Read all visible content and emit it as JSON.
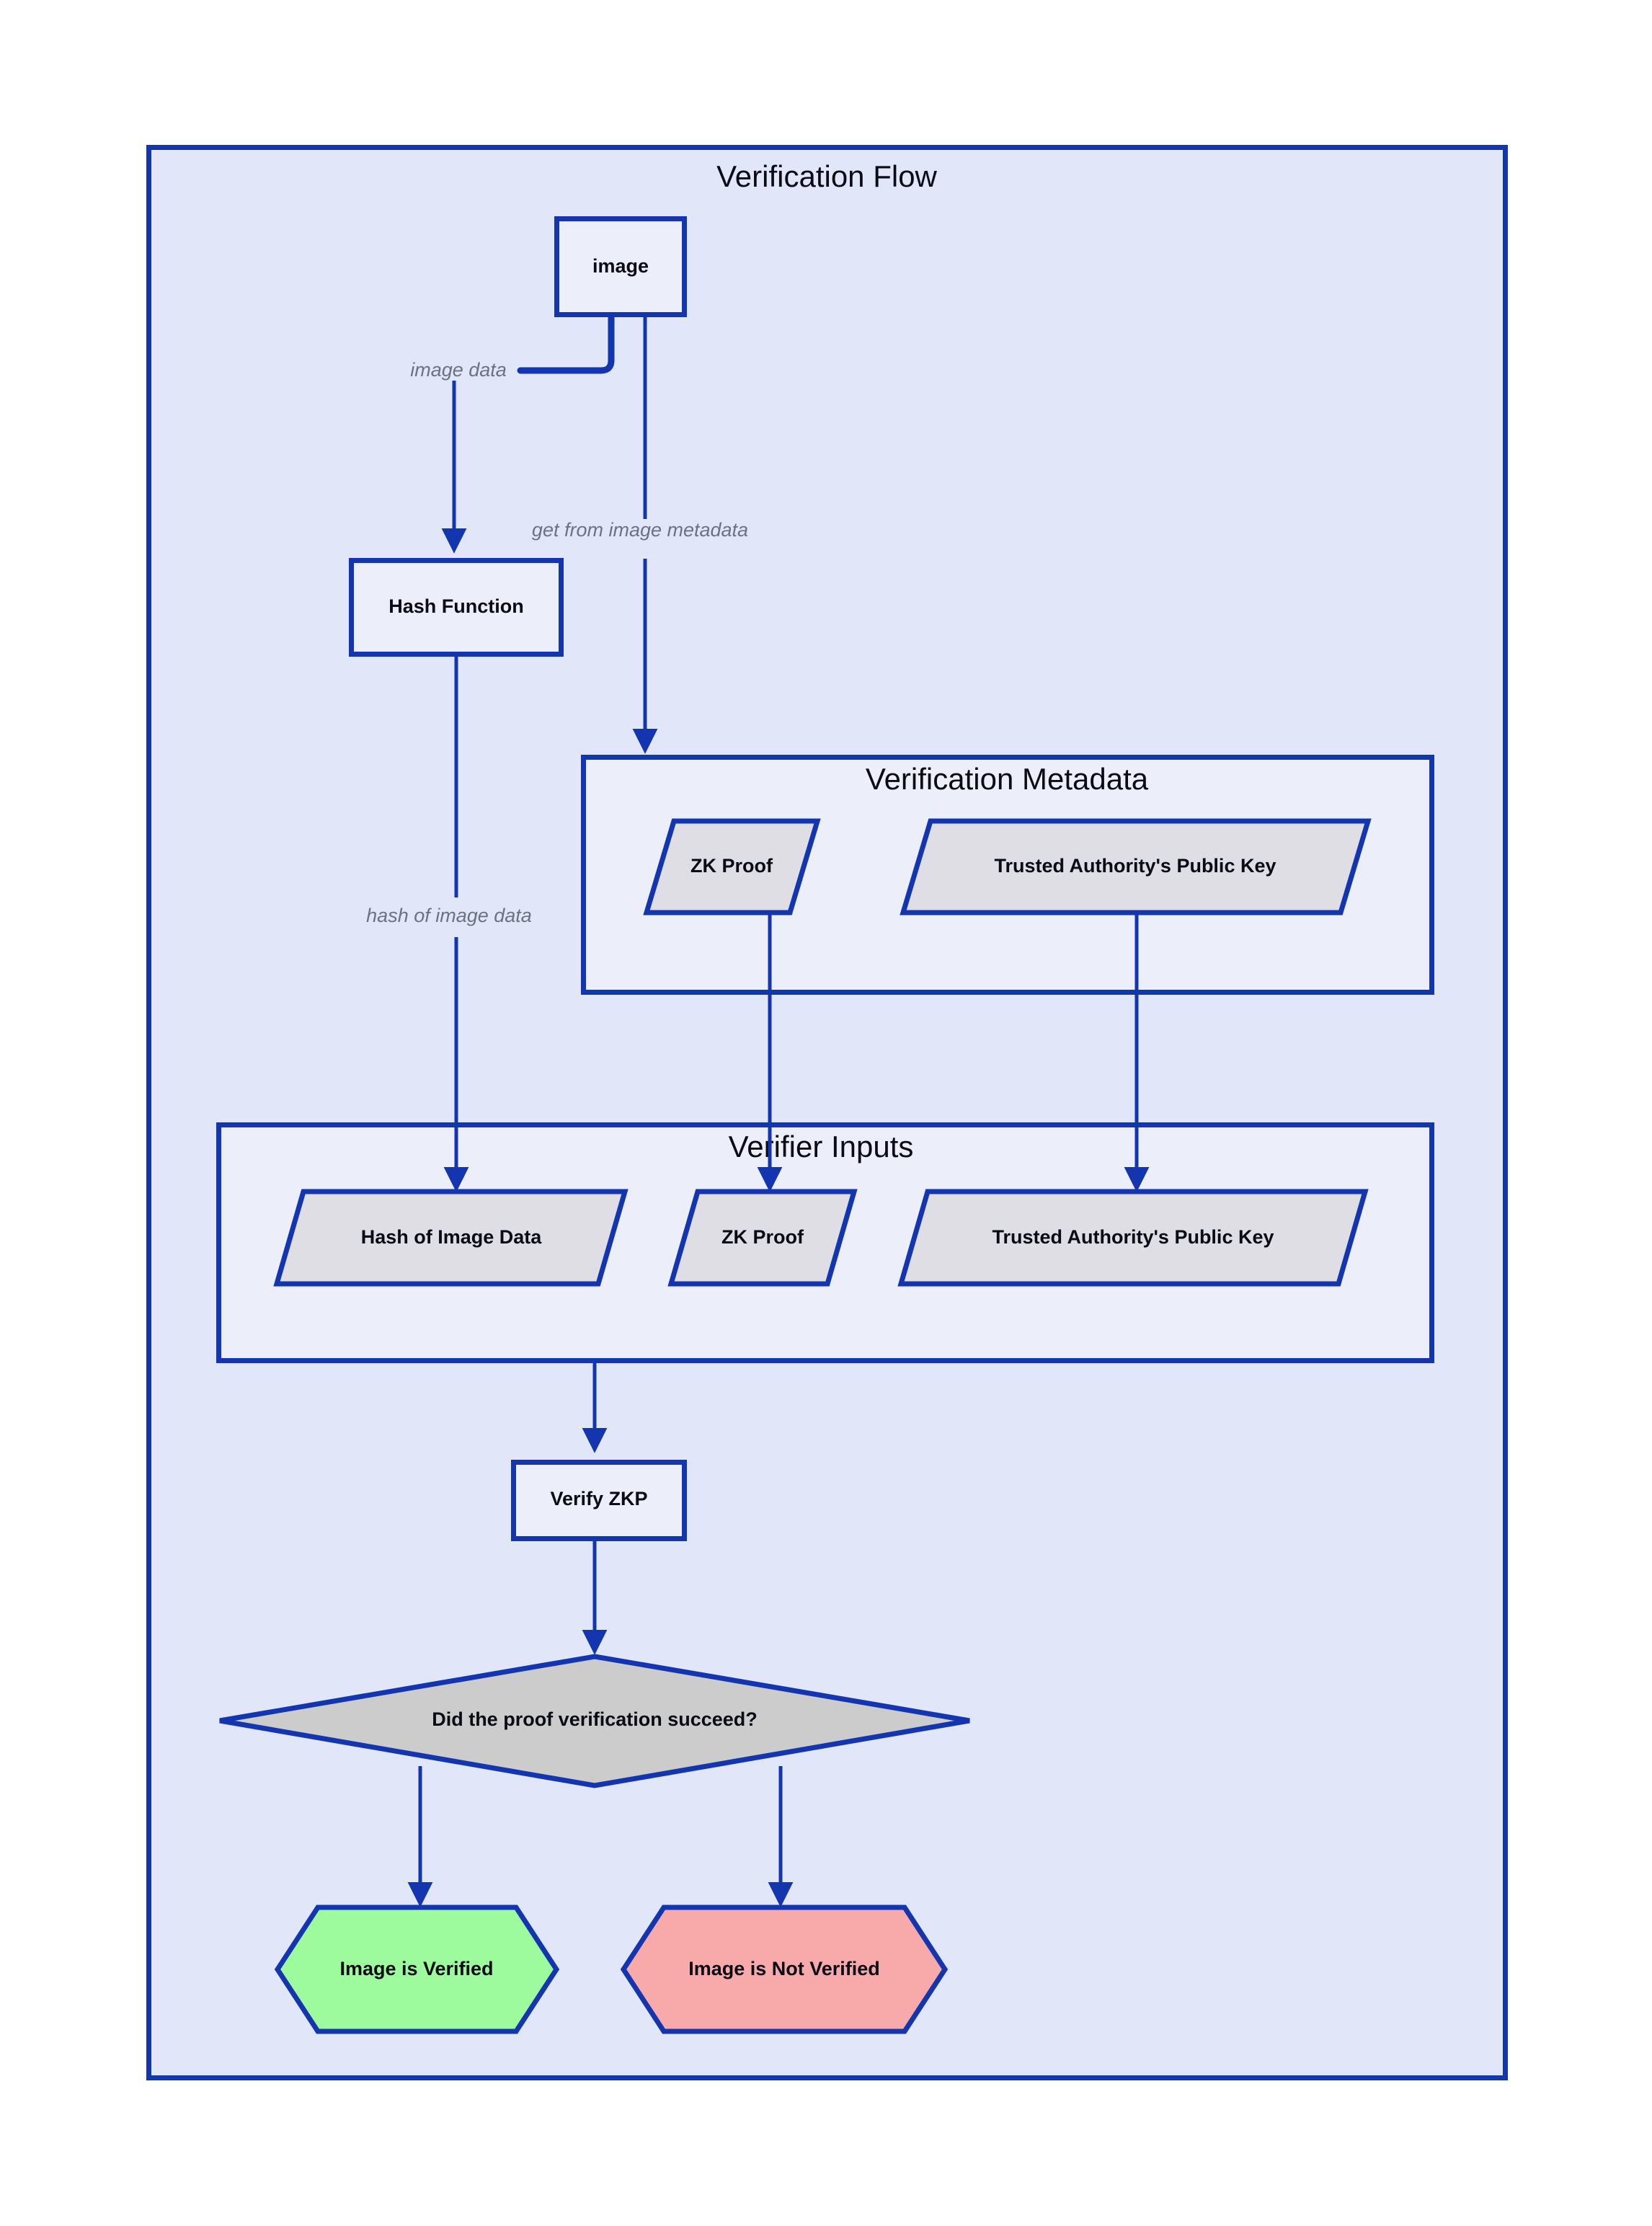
{
  "diagram": {
    "title": "Verification Flow",
    "background_color": "#E1E7F9",
    "border_color": "#1335B0",
    "clusters": [
      {
        "id": "verification_metadata",
        "title": "Verification Metadata"
      },
      {
        "id": "verifier_inputs",
        "title": "Verifier Inputs"
      }
    ],
    "nodes": {
      "image": {
        "label": "image",
        "shape": "rect",
        "fill": "#ECEFF9"
      },
      "hash_function": {
        "label": "Hash Function",
        "shape": "rect",
        "fill": "#ECEFF9"
      },
      "meta_zk_proof": {
        "label": "ZK Proof",
        "shape": "parallelogram",
        "fill": "#DEDEE4"
      },
      "meta_public_key": {
        "label": "Trusted Authority's Public Key",
        "shape": "parallelogram",
        "fill": "#DEDEE4"
      },
      "vi_hash": {
        "label": "Hash of Image Data",
        "shape": "parallelogram",
        "fill": "#DEDEE4"
      },
      "vi_zk_proof": {
        "label": "ZK Proof",
        "shape": "parallelogram",
        "fill": "#DEDEE4"
      },
      "vi_public_key": {
        "label": "Trusted Authority's Public Key",
        "shape": "parallelogram",
        "fill": "#DEDEE4"
      },
      "verify_zkp": {
        "label": "Verify ZKP",
        "shape": "rect",
        "fill": "#ECEFF9"
      },
      "decision": {
        "label": "Did the proof verification succeed?",
        "shape": "diamond",
        "fill": "#CCCCCC"
      },
      "verified": {
        "label": "Image is Verified",
        "shape": "hexagon",
        "fill": "#9DFA9D"
      },
      "not_verified": {
        "label": "Image is Not Verified",
        "shape": "hexagon",
        "fill": "#F8A9A9"
      }
    },
    "edge_labels": {
      "image_data": "image data",
      "get_from_metadata": "get from image metadata",
      "hash_of_image_data": "hash of image data"
    }
  }
}
